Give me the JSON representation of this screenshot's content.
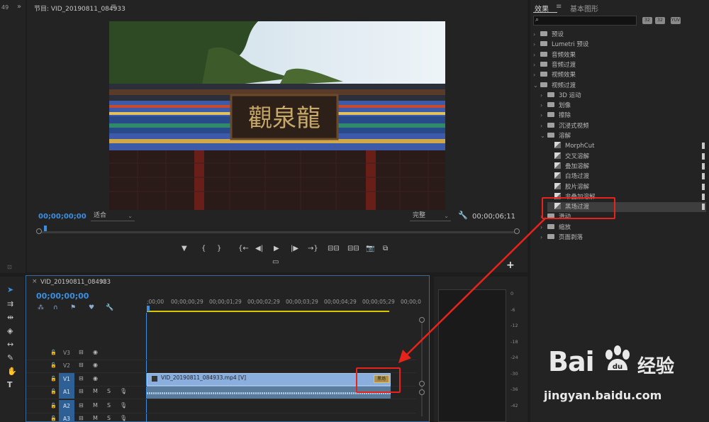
{
  "left_strip": {
    "number": "49",
    "expand": "»"
  },
  "program": {
    "title": "节目: VID_20190811_084933",
    "menu": "≡",
    "image_sign_text": "觀泉龍",
    "timecode_left": "00;00;00;00",
    "fit_value": "适合",
    "resolution_value": "完整",
    "timecode_right": "00;00;06;11",
    "controls": [
      "▼",
      "{",
      "}",
      "{←",
      "◀|",
      "▶",
      "|▶",
      "→}",
      "⊟⊟",
      "⊟⊟",
      "📷",
      "⧉"
    ],
    "add": "+"
  },
  "effects": {
    "tab_active": "效果",
    "tab_menu": "≡",
    "tab_other": "基本图形",
    "search_icon": "⌕",
    "buttons": [
      "32",
      "32",
      "YUV"
    ],
    "tree": [
      {
        "label": "预设",
        "level": 0,
        "kind": "folder"
      },
      {
        "label": "Lumetri 预设",
        "level": 0,
        "kind": "folder"
      },
      {
        "label": "音频效果",
        "level": 0,
        "kind": "folder"
      },
      {
        "label": "音频过渡",
        "level": 0,
        "kind": "folder"
      },
      {
        "label": "视频效果",
        "level": 0,
        "kind": "folder"
      },
      {
        "label": "视频过渡",
        "level": 0,
        "kind": "folder",
        "open": true
      },
      {
        "label": "3D 运动",
        "level": 1,
        "kind": "folder"
      },
      {
        "label": "划像",
        "level": 1,
        "kind": "folder"
      },
      {
        "label": "擦除",
        "level": 1,
        "kind": "folder"
      },
      {
        "label": "沉浸式视频",
        "level": 1,
        "kind": "folder"
      },
      {
        "label": "溶解",
        "level": 1,
        "kind": "folder",
        "open": true
      },
      {
        "label": "MorphCut",
        "level": 2,
        "kind": "effect"
      },
      {
        "label": "交叉溶解",
        "level": 2,
        "kind": "effect"
      },
      {
        "label": "叠加溶解",
        "level": 2,
        "kind": "effect"
      },
      {
        "label": "白场过渡",
        "level": 2,
        "kind": "effect"
      },
      {
        "label": "胶片溶解",
        "level": 2,
        "kind": "effect"
      },
      {
        "label": "非叠加溶解",
        "level": 2,
        "kind": "effect"
      },
      {
        "label": "黑场过渡",
        "level": 2,
        "kind": "effect",
        "selected": true
      },
      {
        "label": "滑动",
        "level": 1,
        "kind": "folder"
      },
      {
        "label": "缩放",
        "level": 1,
        "kind": "folder"
      },
      {
        "label": "页面剥落",
        "level": 1,
        "kind": "folder"
      }
    ]
  },
  "timeline": {
    "title": "VID_20190811_084933",
    "menu": "≡",
    "timecode": "00;00;00;00",
    "ruler": [
      ";00;00",
      "00;00;00;29",
      "00;00;01;29",
      "00;00;02;29",
      "00;00;03;29",
      "00;00;04;29",
      "00;00;05;29",
      "00;00;0"
    ],
    "tracks": [
      {
        "name": "V3",
        "type": "video",
        "targeted": false
      },
      {
        "name": "V2",
        "type": "video",
        "targeted": false
      },
      {
        "name": "V1",
        "type": "video",
        "targeted": true
      },
      {
        "name": "A1",
        "type": "audio",
        "targeted": true
      },
      {
        "name": "A2",
        "type": "audio",
        "targeted": true
      },
      {
        "name": "A3",
        "type": "audio",
        "targeted": true
      }
    ],
    "clip_name": "VID_20190811_084933.mp4 [V]",
    "transition_label": "黑场",
    "mute": "M",
    "solo": "S"
  },
  "meter": {
    "db_labels": [
      "0",
      "-6",
      "-12",
      "-18",
      "-24",
      "-30",
      "-36",
      "-42"
    ]
  },
  "watermark": {
    "brand": "Bai",
    "brand_cn": "经验",
    "url": "jingyan.baidu.com"
  },
  "colors": {
    "accent": "#3a8fe0",
    "annotation": "#e8231b",
    "clip_video": "#8aaede",
    "panel": "#232323"
  }
}
